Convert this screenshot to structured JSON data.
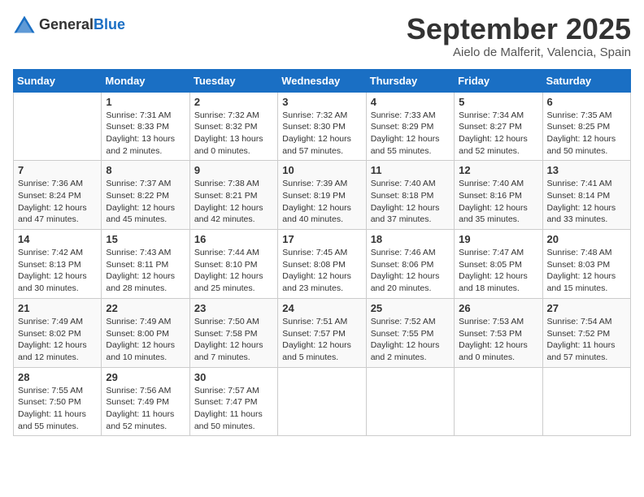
{
  "header": {
    "logo_general": "General",
    "logo_blue": "Blue",
    "month": "September 2025",
    "location": "Aielo de Malferit, Valencia, Spain"
  },
  "weekdays": [
    "Sunday",
    "Monday",
    "Tuesday",
    "Wednesday",
    "Thursday",
    "Friday",
    "Saturday"
  ],
  "weeks": [
    [
      {
        "day": null,
        "info": null
      },
      {
        "day": "1",
        "info": "Sunrise: 7:31 AM\nSunset: 8:33 PM\nDaylight: 13 hours\nand 2 minutes."
      },
      {
        "day": "2",
        "info": "Sunrise: 7:32 AM\nSunset: 8:32 PM\nDaylight: 13 hours\nand 0 minutes."
      },
      {
        "day": "3",
        "info": "Sunrise: 7:32 AM\nSunset: 8:30 PM\nDaylight: 12 hours\nand 57 minutes."
      },
      {
        "day": "4",
        "info": "Sunrise: 7:33 AM\nSunset: 8:29 PM\nDaylight: 12 hours\nand 55 minutes."
      },
      {
        "day": "5",
        "info": "Sunrise: 7:34 AM\nSunset: 8:27 PM\nDaylight: 12 hours\nand 52 minutes."
      },
      {
        "day": "6",
        "info": "Sunrise: 7:35 AM\nSunset: 8:25 PM\nDaylight: 12 hours\nand 50 minutes."
      }
    ],
    [
      {
        "day": "7",
        "info": "Sunrise: 7:36 AM\nSunset: 8:24 PM\nDaylight: 12 hours\nand 47 minutes."
      },
      {
        "day": "8",
        "info": "Sunrise: 7:37 AM\nSunset: 8:22 PM\nDaylight: 12 hours\nand 45 minutes."
      },
      {
        "day": "9",
        "info": "Sunrise: 7:38 AM\nSunset: 8:21 PM\nDaylight: 12 hours\nand 42 minutes."
      },
      {
        "day": "10",
        "info": "Sunrise: 7:39 AM\nSunset: 8:19 PM\nDaylight: 12 hours\nand 40 minutes."
      },
      {
        "day": "11",
        "info": "Sunrise: 7:40 AM\nSunset: 8:18 PM\nDaylight: 12 hours\nand 37 minutes."
      },
      {
        "day": "12",
        "info": "Sunrise: 7:40 AM\nSunset: 8:16 PM\nDaylight: 12 hours\nand 35 minutes."
      },
      {
        "day": "13",
        "info": "Sunrise: 7:41 AM\nSunset: 8:14 PM\nDaylight: 12 hours\nand 33 minutes."
      }
    ],
    [
      {
        "day": "14",
        "info": "Sunrise: 7:42 AM\nSunset: 8:13 PM\nDaylight: 12 hours\nand 30 minutes."
      },
      {
        "day": "15",
        "info": "Sunrise: 7:43 AM\nSunset: 8:11 PM\nDaylight: 12 hours\nand 28 minutes."
      },
      {
        "day": "16",
        "info": "Sunrise: 7:44 AM\nSunset: 8:10 PM\nDaylight: 12 hours\nand 25 minutes."
      },
      {
        "day": "17",
        "info": "Sunrise: 7:45 AM\nSunset: 8:08 PM\nDaylight: 12 hours\nand 23 minutes."
      },
      {
        "day": "18",
        "info": "Sunrise: 7:46 AM\nSunset: 8:06 PM\nDaylight: 12 hours\nand 20 minutes."
      },
      {
        "day": "19",
        "info": "Sunrise: 7:47 AM\nSunset: 8:05 PM\nDaylight: 12 hours\nand 18 minutes."
      },
      {
        "day": "20",
        "info": "Sunrise: 7:48 AM\nSunset: 8:03 PM\nDaylight: 12 hours\nand 15 minutes."
      }
    ],
    [
      {
        "day": "21",
        "info": "Sunrise: 7:49 AM\nSunset: 8:02 PM\nDaylight: 12 hours\nand 12 minutes."
      },
      {
        "day": "22",
        "info": "Sunrise: 7:49 AM\nSunset: 8:00 PM\nDaylight: 12 hours\nand 10 minutes."
      },
      {
        "day": "23",
        "info": "Sunrise: 7:50 AM\nSunset: 7:58 PM\nDaylight: 12 hours\nand 7 minutes."
      },
      {
        "day": "24",
        "info": "Sunrise: 7:51 AM\nSunset: 7:57 PM\nDaylight: 12 hours\nand 5 minutes."
      },
      {
        "day": "25",
        "info": "Sunrise: 7:52 AM\nSunset: 7:55 PM\nDaylight: 12 hours\nand 2 minutes."
      },
      {
        "day": "26",
        "info": "Sunrise: 7:53 AM\nSunset: 7:53 PM\nDaylight: 12 hours\nand 0 minutes."
      },
      {
        "day": "27",
        "info": "Sunrise: 7:54 AM\nSunset: 7:52 PM\nDaylight: 11 hours\nand 57 minutes."
      }
    ],
    [
      {
        "day": "28",
        "info": "Sunrise: 7:55 AM\nSunset: 7:50 PM\nDaylight: 11 hours\nand 55 minutes."
      },
      {
        "day": "29",
        "info": "Sunrise: 7:56 AM\nSunset: 7:49 PM\nDaylight: 11 hours\nand 52 minutes."
      },
      {
        "day": "30",
        "info": "Sunrise: 7:57 AM\nSunset: 7:47 PM\nDaylight: 11 hours\nand 50 minutes."
      },
      {
        "day": null,
        "info": null
      },
      {
        "day": null,
        "info": null
      },
      {
        "day": null,
        "info": null
      },
      {
        "day": null,
        "info": null
      }
    ]
  ]
}
